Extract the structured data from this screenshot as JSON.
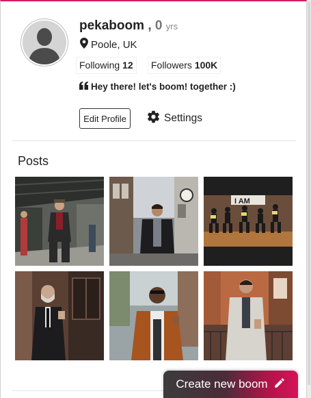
{
  "profile": {
    "username": "pekaboom",
    "separator": ",",
    "age": "0",
    "age_unit": "yrs",
    "location": "Poole, UK",
    "following_label": "Following",
    "following_count": "12",
    "followers_label": "Followers",
    "followers_count": "100K",
    "bio": "Hey there! let's boom! together :)"
  },
  "actions": {
    "edit_profile": "Edit Profile",
    "settings": "Settings"
  },
  "posts": {
    "title": "Posts",
    "items": [
      {
        "subject": "elderly man in suit at train station"
      },
      {
        "subject": "man in black coat on city street"
      },
      {
        "subject": "group dance performance"
      },
      {
        "subject": "bearded man in black suit by door"
      },
      {
        "subject": "man in tan overcoat"
      },
      {
        "subject": "man in grey coat on balcony"
      }
    ]
  },
  "fab": {
    "label": "Create new boom"
  },
  "colors": {
    "accent": "#d81b60",
    "fab_start": "#3c3c3c",
    "fab_end": "#d4145a"
  },
  "icons": {
    "location": "map-marker-icon",
    "bio": "quote-icon",
    "settings": "gear-icon",
    "fab": "pencil-icon"
  }
}
